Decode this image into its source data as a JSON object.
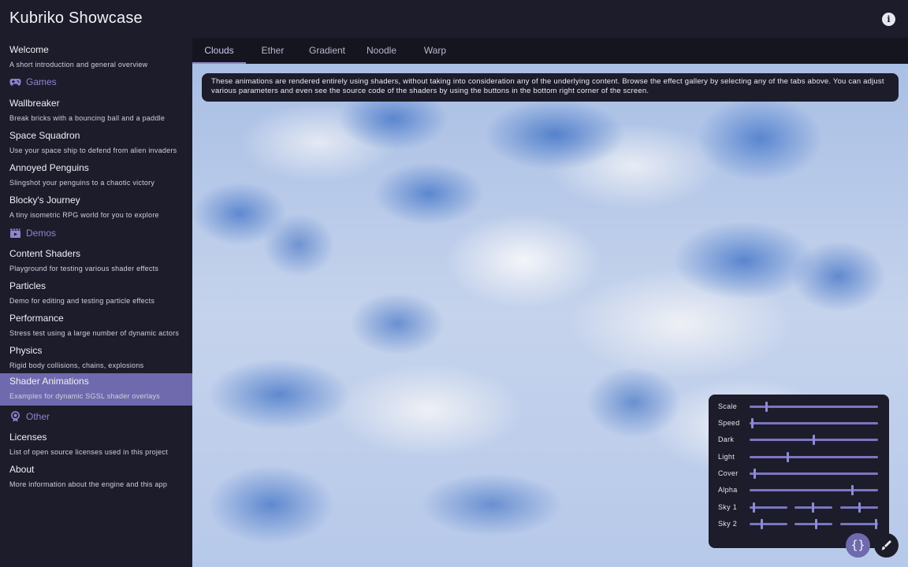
{
  "app": {
    "title": "Kubriko Showcase",
    "info_icon": "info-icon"
  },
  "sidebar": {
    "welcome": {
      "label": "Welcome",
      "desc": "A short introduction and general overview"
    },
    "sections": [
      {
        "label": "Games",
        "icon": "gamepad-icon"
      },
      {
        "label": "Demos",
        "icon": "clapperboard-icon"
      },
      {
        "label": "Other",
        "icon": "badge-icon"
      }
    ],
    "games": [
      {
        "label": "Wallbreaker",
        "desc": "Break bricks with a bouncing ball and a paddle"
      },
      {
        "label": "Space Squadron",
        "desc": "Use your space ship to defend from alien invaders"
      },
      {
        "label": "Annoyed Penguins",
        "desc": "Slingshot your penguins to a chaotic victory"
      },
      {
        "label": "Blocky's Journey",
        "desc": "A tiny isometric RPG world for you to explore"
      }
    ],
    "demos": [
      {
        "label": "Content Shaders",
        "desc": "Playground for testing various shader effects"
      },
      {
        "label": "Particles",
        "desc": "Demo for editing and testing particle effects"
      },
      {
        "label": "Performance",
        "desc": "Stress test using a large number of dynamic actors"
      },
      {
        "label": "Physics",
        "desc": "Rigid body collisions, chains, explosions"
      },
      {
        "label": "Shader Animations",
        "desc": "Examples for dynamic SGSL shader overlays"
      }
    ],
    "other": [
      {
        "label": "Licenses",
        "desc": "List of open source licenses used in this project"
      },
      {
        "label": "About",
        "desc": "More information about the engine and this app"
      }
    ],
    "active_item": "Shader Animations"
  },
  "tabs": [
    {
      "label": "Clouds"
    },
    {
      "label": "Ether"
    },
    {
      "label": "Gradient"
    },
    {
      "label": "Noodle"
    },
    {
      "label": "Warp"
    }
  ],
  "active_tab": "Clouds",
  "banner": {
    "text": "These animations are rendered entirely using shaders, without taking into consideration any of the underlying content. Browse the effect gallery by selecting any of the tabs above. You can adjust various parameters and even see the source code of the shaders by using the buttons in the bottom right corner of the screen."
  },
  "controls": {
    "sliders": [
      {
        "label": "Scale",
        "value": 0.13
      },
      {
        "label": "Speed",
        "value": 0.02
      },
      {
        "label": "Dark",
        "value": 0.5
      },
      {
        "label": "Light",
        "value": 0.3
      },
      {
        "label": "Cover",
        "value": 0.04
      },
      {
        "label": "Alpha",
        "value": 0.8
      }
    ],
    "rgb_sliders": [
      {
        "label": "Sky 1",
        "values": [
          0.12,
          0.48,
          0.5
        ]
      },
      {
        "label": "Sky 2",
        "values": [
          0.33,
          0.57,
          0.95
        ]
      }
    ]
  },
  "buttons": {
    "code": {
      "label": "{}",
      "icon": "code-braces-icon"
    },
    "edit": {
      "icon": "brush-icon"
    }
  },
  "colors": {
    "accent": "#6f6aae",
    "section": "#8c86cc",
    "background": "#1c1c2b"
  }
}
